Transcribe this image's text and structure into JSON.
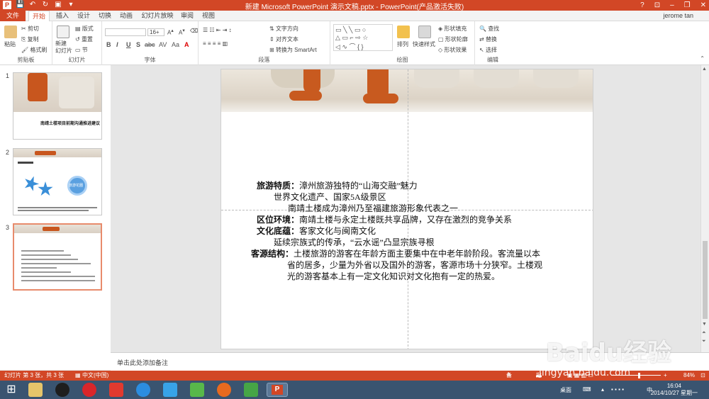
{
  "window": {
    "title": "新建 Microsoft PowerPoint 演示文稿.pptx - PowerPoint(产品激活失败)",
    "user": "jerome tan",
    "help": "?",
    "minimize": "–",
    "restore": "❐",
    "close": "✕"
  },
  "tabs": [
    "文件",
    "开始",
    "插入",
    "设计",
    "切换",
    "动画",
    "幻灯片放映",
    "审阅",
    "视图"
  ],
  "ribbon": {
    "clipboard": {
      "label": "剪贴板",
      "paste": "粘贴",
      "cut": "剪切",
      "copy": "复制",
      "format_painter": "格式刷"
    },
    "slides": {
      "label": "幻灯片",
      "new_slide": "新建\n幻灯片",
      "layout": "版式",
      "reset": "重置",
      "section": "节"
    },
    "font": {
      "label": "字体",
      "font_size": "16+",
      "bold": "B",
      "italic": "I",
      "underline": "U",
      "strike": "S",
      "shadow": "abc",
      "spacing": "AV",
      "case": "Aa",
      "color": "A"
    },
    "paragraph": {
      "label": "段落",
      "text_direction": "文字方向",
      "align_text": "对齐文本",
      "smartart": "转换为 SmartArt"
    },
    "drawing": {
      "label": "绘图",
      "arrange": "排列",
      "quick_styles": "快速样式",
      "shape_fill": "形状填充",
      "shape_outline": "形状轮廓",
      "shape_effects": "形状效果"
    },
    "editing": {
      "label": "编辑",
      "find": "查找",
      "replace": "替换",
      "select": "选择"
    }
  },
  "thumbnails": [
    {
      "num": "1",
      "title": "南靖土楼项目前期沟通推进建议"
    },
    {
      "num": "2",
      "center": "旅游花圈"
    },
    {
      "num": "3"
    }
  ],
  "slide": {
    "lines": [
      {
        "label": "旅游特质：",
        "text": "漳州旅游独特的“山海交融”魅力"
      },
      {
        "label": "",
        "text": "世界文化遗产、国家5A级景区"
      },
      {
        "label": "",
        "text": "南靖土楼成为漳州乃至福建旅游形象代表之一"
      },
      {
        "label": "区位环境：",
        "text": "南靖土楼与永定土楼既共享品牌，又存在激烈的竞争关系"
      },
      {
        "label": "文化底蕴：",
        "text": "客家文化与闽南文化"
      },
      {
        "label": "",
        "text": "延续宗族式的传承，“云水谣”凸显宗族寻根"
      },
      {
        "label": "客源结构：",
        "text": "土楼旅游的游客在年龄方面主要集中在中老年龄阶段。客流量以本"
      },
      {
        "label": "",
        "text": "省的居多，少量为外省以及国外的游客，客源市场十分狭窄。土楼观"
      },
      {
        "label": "",
        "text": "光的游客基本上有一定文化知识对文化抱有一定的热爱。"
      }
    ]
  },
  "notes": {
    "placeholder": "单击此处添加备注"
  },
  "status": {
    "slide_info": "幻灯片 第 3 张，共 3 张",
    "language": "中文(中国)",
    "notes": "备注",
    "comments": "批注",
    "zoom": "84%"
  },
  "taskbar": {
    "desktop": "桌面",
    "ime": "中",
    "time": "16:04",
    "date": "2014/10/27 星期一"
  },
  "watermark": {
    "brand": "Baidu经验",
    "url": "jingyan.baidu.com"
  },
  "colors": {
    "accent": "#d24726",
    "taskbar": "#3a5470"
  }
}
